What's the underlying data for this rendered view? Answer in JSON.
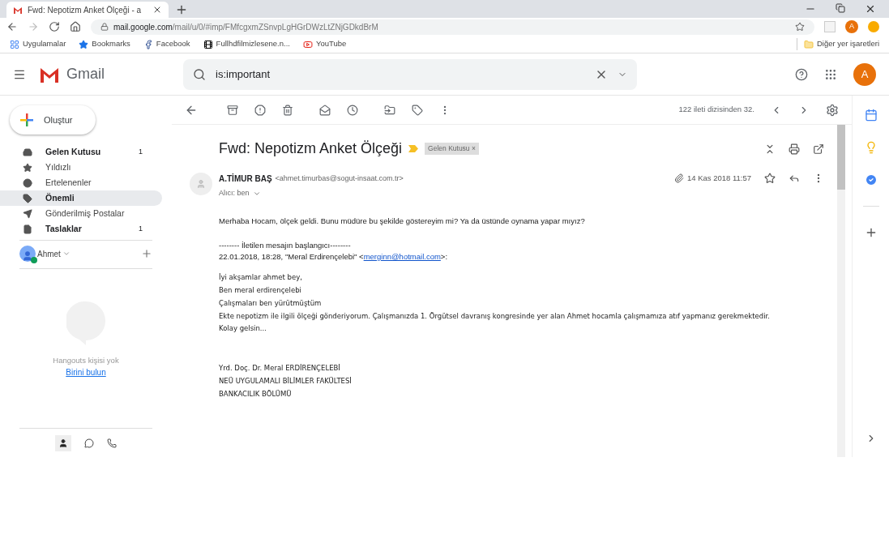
{
  "browser": {
    "tab_title": "Fwd: Nepotizm Anket Ölçeği - a",
    "url_host": "mail.google.com",
    "url_path": "/mail/u/0/#imp/FMfcgxmZSnvpLgHGrDWzLtZNjGDkdBrM",
    "profile_initial": "A",
    "bookmarks": [
      {
        "label": "Uygulamalar"
      },
      {
        "label": "Bookmarks"
      },
      {
        "label": "Facebook"
      },
      {
        "label": "Fullhdfilmizlesene.n..."
      },
      {
        "label": "YouTube"
      }
    ],
    "other_bookmarks": "Diğer yer işaretleri"
  },
  "gmail": {
    "app_name": "Gmail",
    "search": {
      "value": "is:important"
    },
    "account_initial": "A",
    "compose": "Oluştur",
    "nav": [
      {
        "label": "Gelen Kutusu",
        "count": "1",
        "unread": true,
        "selected": false
      },
      {
        "label": "Yıldızlı",
        "unread": false,
        "selected": false
      },
      {
        "label": "Ertelenenler",
        "unread": false,
        "selected": false
      },
      {
        "label": "Önemli",
        "unread": true,
        "selected": true
      },
      {
        "label": "Gönderilmiş Postalar",
        "unread": false,
        "selected": false
      },
      {
        "label": "Taslaklar",
        "count": "1",
        "unread": true,
        "selected": false
      }
    ],
    "hangouts": {
      "user": "Ahmet",
      "empty": "Hangouts kişisi yok",
      "find": "Birini bulun"
    },
    "pagination": "122 ileti dizisinden 32.",
    "message": {
      "subject": "Fwd: Nepotizm Anket Ölçeği",
      "label": "Gelen Kutusu",
      "label_close": "×",
      "sender": "A.TİMUR BAŞ",
      "sender_email": "<ahmet.timurbas@sogut-insaat.com.tr>",
      "recipient": "Alıcı: ben",
      "date": "14 Kas 2018 11:57",
      "intro": "Merhaba Hocam, ölçek geldi. Bunu müdüre bu şekilde göstereyim mi? Ya da üstünde oynama yapar mıyız?",
      "forward_header": "-------- İletilen mesajın başlangıcı--------",
      "forward_from": {
        "before": "22.01.2018, 18:28, \"Meral Erdirençelebi\" <",
        "link": "merginn@hotmail.com",
        "after": ">:"
      },
      "quoted": [
        "İyi akşamlar ahmet bey,",
        "Ben meral erdirençelebi",
        "Çalışmaları ben yürütmüştüm",
        "Ekte nepotizm ile ilgili ölçeği gönderiyorum. Çalışmanızda 1. Örgütsel davranış kongresinde yer alan Ahmet hocamla çalışmamıza atıf yapmanız gerekmektedir.",
        "Kolay gelsin..."
      ],
      "signature": [
        "Yrd. Doç. Dr. Meral ERDİRENÇELEBİ",
        "NEÜ UYGULAMALI BİLİMLER FAKÜLTESİ",
        "BANKACILIK BÖLÜMÜ"
      ]
    }
  }
}
